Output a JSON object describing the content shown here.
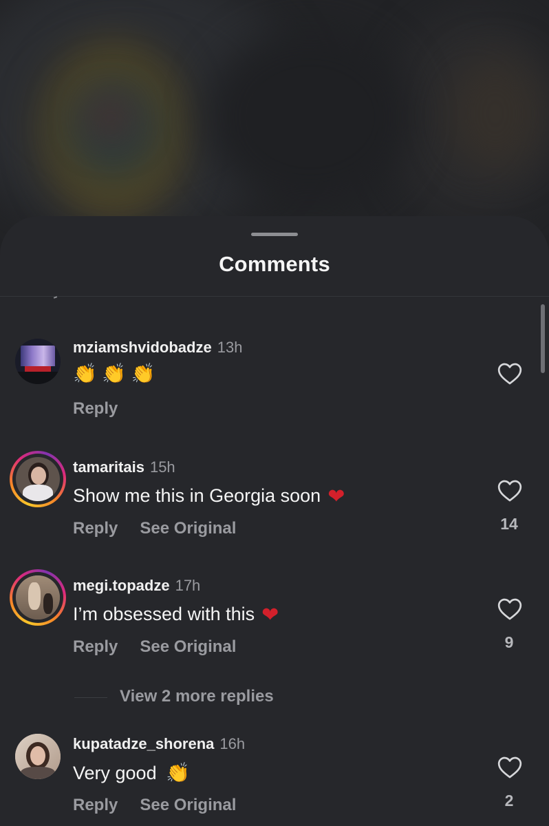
{
  "sheet": {
    "title": "Comments"
  },
  "comments": [
    {
      "username": "mziamshvidobadze",
      "time": "13h",
      "text": "",
      "emojis": [
        "👏",
        "👏",
        "👏"
      ],
      "reply_label": "Reply",
      "see_original_label": "",
      "like_count": ""
    },
    {
      "username": "tamaritais",
      "time": "15h",
      "text": "Show me this in Georgia soon",
      "emoji": "❤",
      "reply_label": "Reply",
      "see_original_label": "See Original",
      "like_count": "14"
    },
    {
      "username": "megi.topadze",
      "time": "17h",
      "text": "I’m obsessed with this",
      "emoji": "❤",
      "reply_label": "Reply",
      "see_original_label": "See Original",
      "like_count": "9",
      "view_replies_label": "View 2 more replies"
    },
    {
      "username": "kupatadze_shorena",
      "time": "16h",
      "text": "Very good",
      "emoji": "👏",
      "reply_label": "Reply",
      "see_original_label": "See Original",
      "like_count": "2"
    }
  ],
  "icons": {
    "like": "heart-outline-icon",
    "emoji_heart": "red-heart-icon",
    "emoji_clap": "clapping-hands-icon"
  },
  "colors": {
    "sheet_bg": "#26272b",
    "text_primary": "#f5f5f5",
    "text_secondary": "#9a9ba0",
    "story_ring_start": "#f9c62a",
    "story_ring_end": "#8134af"
  }
}
